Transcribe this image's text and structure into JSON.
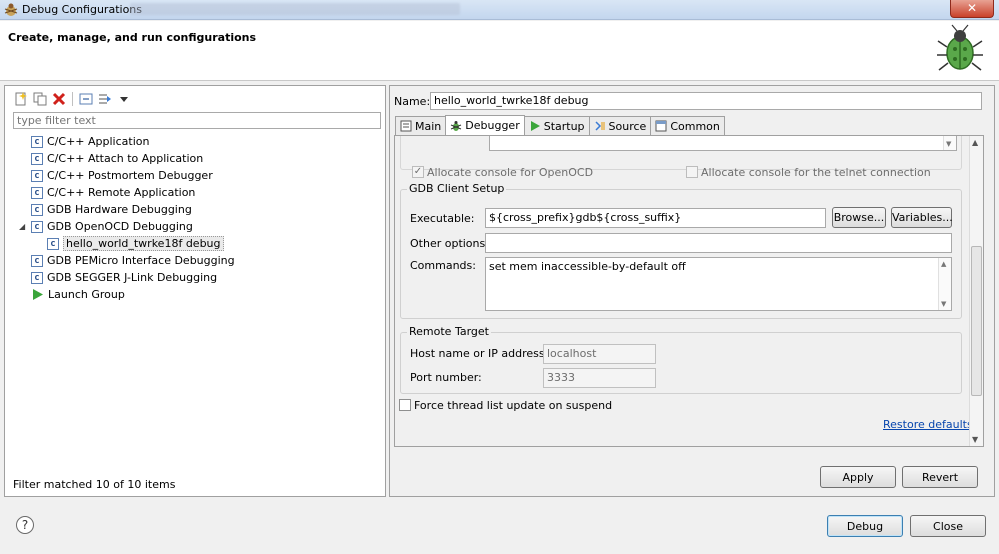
{
  "window": {
    "title": "Debug Configurations",
    "close_glyph": "✕"
  },
  "banner": {
    "heading": "Create, manage, and run configurations",
    "icon": "bug-icon"
  },
  "left": {
    "filter_placeholder": "type filter text",
    "tree": [
      {
        "label": "C/C++ Application",
        "icon": "c-config-icon",
        "indent": 0
      },
      {
        "label": "C/C++ Attach to Application",
        "icon": "c-config-icon",
        "indent": 0
      },
      {
        "label": "C/C++ Postmortem Debugger",
        "icon": "c-config-icon",
        "indent": 0
      },
      {
        "label": "C/C++ Remote Application",
        "icon": "c-config-icon",
        "indent": 0
      },
      {
        "label": "GDB Hardware Debugging",
        "icon": "c-config-icon",
        "indent": 0
      },
      {
        "label": "GDB OpenOCD Debugging",
        "icon": "c-config-icon",
        "indent": 0,
        "expanded": true
      },
      {
        "label": "hello_world_twrke18f debug",
        "icon": "c-config-icon",
        "indent": 1,
        "selected": true
      },
      {
        "label": "GDB PEMicro Interface Debugging",
        "icon": "c-config-icon",
        "indent": 0
      },
      {
        "label": "GDB SEGGER J-Link Debugging",
        "icon": "c-config-icon",
        "indent": 0
      },
      {
        "label": "Launch Group",
        "icon": "launch-group-icon",
        "indent": 0
      }
    ],
    "filter_status": "Filter matched 10 of 10 items"
  },
  "right": {
    "name_label": "Name:",
    "name_value": "hello_world_twrke18f debug",
    "tabs": [
      {
        "label": "Main",
        "icon": "main-tab-icon"
      },
      {
        "label": "Debugger",
        "icon": "debugger-tab-icon",
        "active": true
      },
      {
        "label": "Startup",
        "icon": "startup-tab-icon"
      },
      {
        "label": "Source",
        "icon": "source-tab-icon"
      },
      {
        "label": "Common",
        "icon": "common-tab-icon"
      }
    ],
    "allocate_openocd": "Allocate console for OpenOCD",
    "allocate_telnet": "Allocate console for the telnet connection",
    "gdb_client": {
      "title": "GDB Client Setup",
      "executable_label": "Executable:",
      "executable_value": "${cross_prefix}gdb${cross_suffix}",
      "browse": "Browse...",
      "variables": "Variables...",
      "other_options_label": "Other options:",
      "commands_label": "Commands:",
      "commands_value": "set mem inaccessible-by-default off"
    },
    "remote_target": {
      "title": "Remote Target",
      "host_label": "Host name or IP address:",
      "host_value": "localhost",
      "port_label": "Port number:",
      "port_value": "3333"
    },
    "force_thread": "Force thread list update on suspend",
    "restore_defaults": "Restore defaults",
    "apply": "Apply",
    "revert": "Revert"
  },
  "footer": {
    "help": "?",
    "debug": "Debug",
    "close": "Close"
  }
}
